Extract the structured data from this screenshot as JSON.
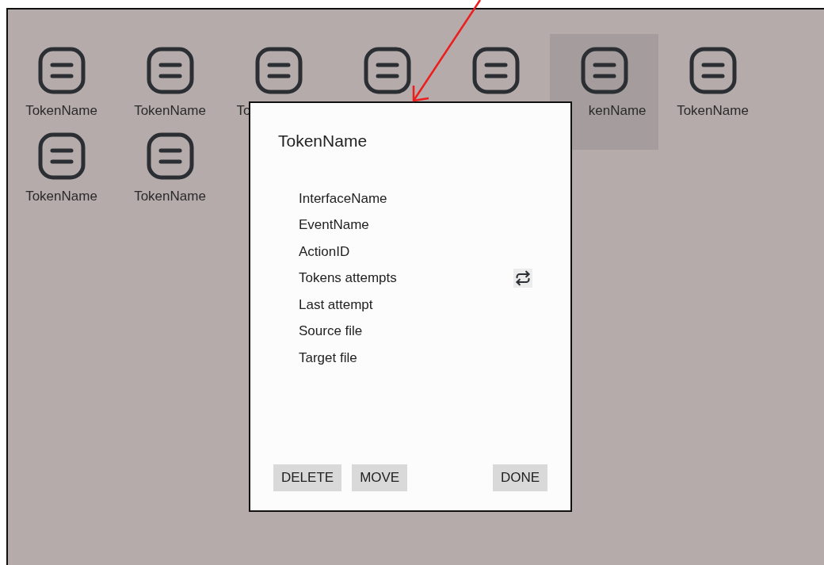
{
  "tokens": [
    {
      "kind": "full",
      "label": "TokenName",
      "selected": false
    },
    {
      "kind": "full",
      "label": "TokenName",
      "selected": false
    },
    {
      "kind": "tail",
      "label": "To",
      "selected": false
    },
    {
      "kind": "hidden",
      "selected": false
    },
    {
      "kind": "hidden",
      "selected": false
    },
    {
      "kind": "head",
      "label": "kenName",
      "selected": true
    },
    {
      "kind": "full",
      "label": "TokenName",
      "selected": false
    },
    {
      "kind": "full",
      "label": "TokenName",
      "selected": false
    },
    {
      "kind": "full",
      "label": "TokenName",
      "selected": false
    }
  ],
  "dialog": {
    "title": "TokenName",
    "fields": [
      {
        "kind": "text",
        "label": "InterfaceName"
      },
      {
        "kind": "text",
        "label": "EventName"
      },
      {
        "kind": "text",
        "label": "ActionID"
      },
      {
        "kind": "repeat",
        "label": "Tokens attempts"
      },
      {
        "kind": "text",
        "label": "Last attempt"
      },
      {
        "kind": "text",
        "label": "Source file"
      },
      {
        "kind": "text",
        "label": "Target file"
      }
    ],
    "buttons": [
      {
        "kind": "secondary",
        "label": "DELETE"
      },
      {
        "kind": "secondary",
        "label": "MOVE"
      },
      {
        "kind": "primary",
        "label": "DONE"
      }
    ]
  }
}
